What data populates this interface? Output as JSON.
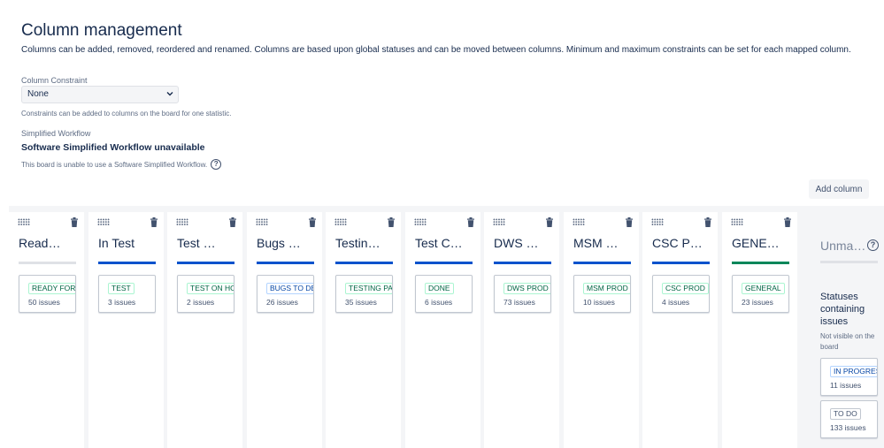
{
  "page": {
    "title": "Column management",
    "description": "Columns can be added, removed, reordered and renamed. Columns are based upon global statuses and can be moved between columns. Minimum and maximum constraints can be set for each mapped column."
  },
  "constraint": {
    "label": "Column Constraint",
    "value": "None",
    "help": "Constraints can be added to columns on the board for one statistic."
  },
  "workflow": {
    "label": "Simplified Workflow",
    "title": "Software Simplified Workflow unavailable",
    "note": "This board is unable to use a Software Simplified Workflow."
  },
  "toolbar": {
    "add_column_label": "Add column"
  },
  "columns": [
    {
      "name": "Read…",
      "status": "READY FOR T",
      "count": "50 issues"
    },
    {
      "name": "In Test",
      "status": "TEST",
      "count": "3 issues"
    },
    {
      "name": "Test …",
      "status": "TEST ON HO",
      "count": "2 issues"
    },
    {
      "name": "Bugs …",
      "status": "BUGS TO DEV",
      "count": "26 issues"
    },
    {
      "name": "Testin…",
      "status": "TESTING PAS",
      "count": "35 issues"
    },
    {
      "name": "Test C…",
      "status": "DONE",
      "count": "6 issues"
    },
    {
      "name": "DWS …",
      "status": "DWS PROD",
      "count": "73 issues"
    },
    {
      "name": "MSM …",
      "status": "MSM PROD",
      "count": "10 issues"
    },
    {
      "name": "CSC P…",
      "status": "CSC PROD",
      "count": "4 issues"
    },
    {
      "name": "GENE…",
      "status": "GENERAL",
      "count": "23 issues"
    }
  ],
  "unmapped": {
    "title": "Unma…",
    "heading": "Statuses containing issues",
    "note": "Not visible on the board",
    "cards": [
      {
        "status": "IN PROGRESS",
        "count": "11 issues"
      },
      {
        "status": "TO DO",
        "count": "133 issues"
      }
    ]
  },
  "colors": {
    "bar_blue": "#0052cc",
    "bar_green": "#00875a",
    "bar_grey": "#dfe1e6",
    "status_green": "#006644",
    "status_blue": "#0747a6",
    "status_grey": "#42526e"
  },
  "icons": {
    "drag_handle": "drag-handle-icon",
    "delete": "trash-icon",
    "help": "question-circle-icon",
    "dropdown": "chevron-down-icon"
  }
}
